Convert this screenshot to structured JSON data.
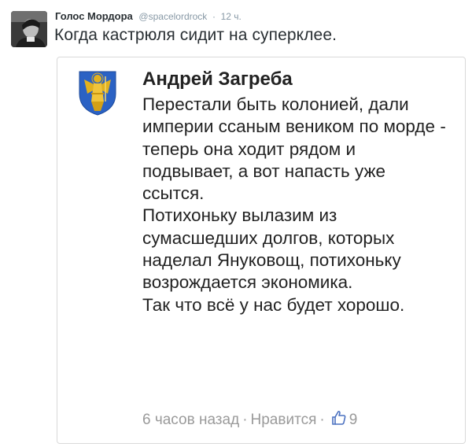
{
  "tweet": {
    "author_name": "Голос Мордора",
    "handle": "@spacelordrock",
    "separator": "·",
    "time": "12 ч.",
    "text": "Когда кастрюля сидит на суперклее."
  },
  "comment": {
    "author": "Андрей Загреба",
    "paragraphs": [
      "Перестали быть колонией, дали империи ссаным веником по морде - теперь она ходит рядом и подвывает, а вот напасть уже ссытся.",
      "Потихоньку вылазим из сумасшедших долгов, которых наделал Януковощ, потихоньку возрождается экономика.",
      "Так что всё у нас будет хорошо."
    ],
    "footer": {
      "time": "6 часов назад",
      "separator": "·",
      "like_label": "Нравится",
      "like_count": "9"
    }
  },
  "colors": {
    "crest_blue": "#2b62c4",
    "crest_gold": "#e2b11e",
    "muted": "#9a9a9a"
  },
  "icons": [
    "user-avatar",
    "coat-of-arms",
    "thumbs-up-icon"
  ]
}
